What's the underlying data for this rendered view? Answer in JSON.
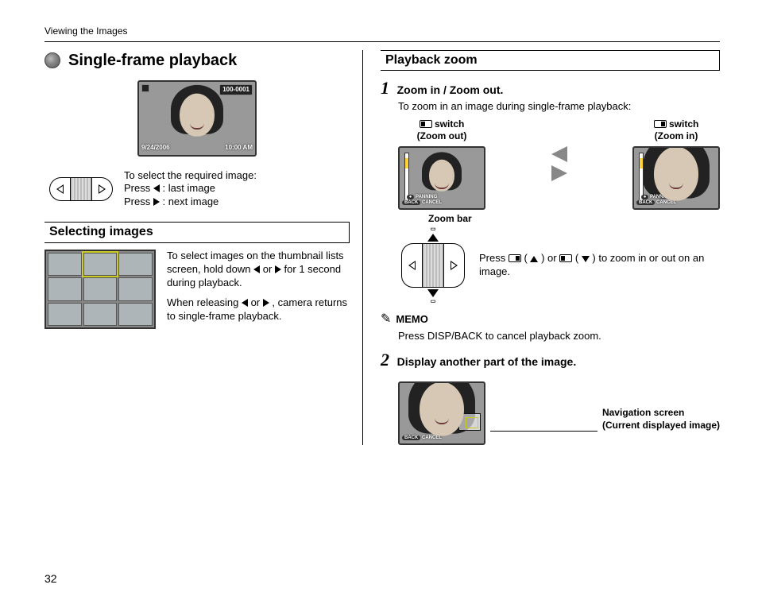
{
  "running_head": "Viewing the Images",
  "page_number": "32",
  "left": {
    "title": "Single-frame playback",
    "top_image": {
      "file_tag": "100-0001",
      "date": "9/24/2006",
      "time": "10:00 AM"
    },
    "select_instr": {
      "lead": "To select the required image:",
      "last": ": last image",
      "next": ": next image",
      "press": "Press "
    },
    "selecting_heading": "Selecting images",
    "selecting_body1": "To select images on the thumbnail lists screen, hold down ",
    "selecting_body1_mid": " or ",
    "selecting_body1_end": " for 1 second during playback.",
    "selecting_body2a": "When releasing ",
    "selecting_body2_mid": " or ",
    "selecting_body2b": ", camera returns to single-frame playback."
  },
  "right": {
    "heading": "Playback zoom",
    "step1_title": "Zoom in / Zoom out.",
    "step1_intro": "To zoom in an image during single-frame playback:",
    "zoom_out_label_a": " switch",
    "zoom_out_label_b": "(Zoom out)",
    "zoom_in_label_a": " switch",
    "zoom_in_label_b": "(Zoom in)",
    "panning": "PANNING",
    "cancel": "CANCEL",
    "back": "BACK",
    "zoom_bar": "Zoom bar",
    "zoom_instr_a": "Press ",
    "zoom_instr_mid1": "(",
    "zoom_instr_mid2": ") or ",
    "zoom_instr_mid3": "(",
    "zoom_instr_mid4": ") to zoom in or out on an image.",
    "memo_label": "MEMO",
    "memo_body": "Press DISP/BACK to cancel playback zoom.",
    "step2_title": "Display another part of the image.",
    "nav_caption1": "Navigation screen",
    "nav_caption2": "(Current displayed image)"
  }
}
